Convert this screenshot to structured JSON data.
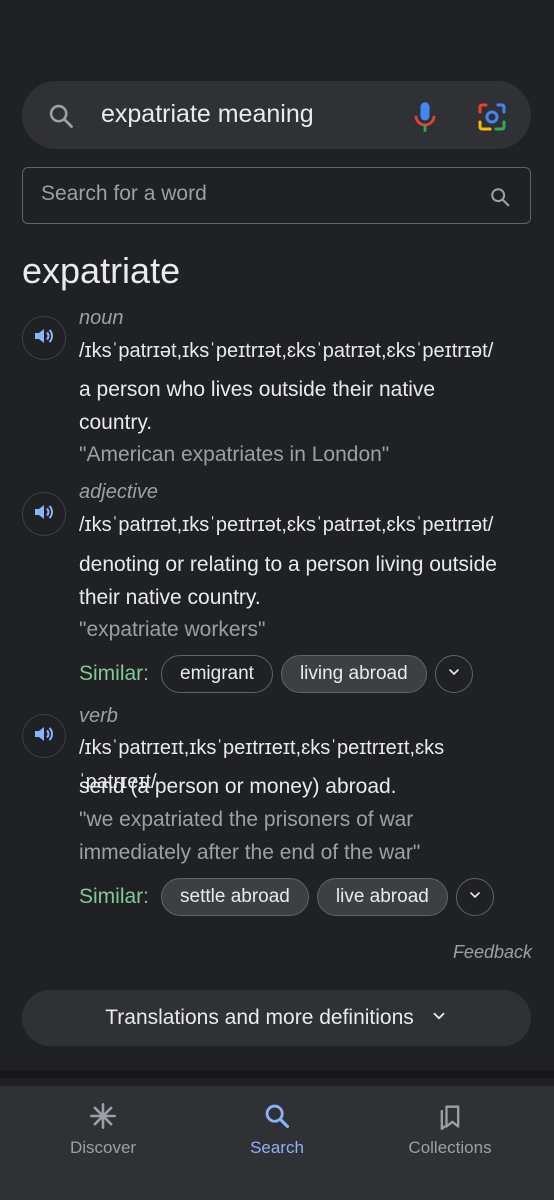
{
  "search": {
    "query": "expatriate meaning"
  },
  "dictionary": {
    "search_placeholder": "Search for a word",
    "headword": "expatriate",
    "entries": [
      {
        "pos": "noun",
        "phonetic": "/ɪksˈpatrɪət,ɪksˈpeɪtrɪət,ɛksˈpatrɪət,ɛksˈpeɪtrɪət/",
        "definition": "a person who lives outside their native country.",
        "example": "\"American expatriates in London\""
      },
      {
        "pos": "adjective",
        "phonetic": "/ɪksˈpatrɪət,ɪksˈpeɪtrɪət,ɛksˈpatrɪət,ɛksˈpeɪtrɪət/",
        "definition": "denoting or relating to a person living outside their native country.",
        "example": "\"expatriate workers\"",
        "similar_label": "Similar:",
        "similar": [
          "emigrant",
          "living abroad"
        ]
      },
      {
        "pos": "verb",
        "phonetic": "/ɪksˈpatrɪeɪt,ɪksˈpeɪtrɪeɪt,ɛksˈpeɪtrɪeɪt,ɛksˈpatrɪeɪt/",
        "definition": "send (a person or money) abroad.",
        "example": "\"we expatriated the prisoners of war immediately after the end of the war\"",
        "similar_label": "Similar:",
        "similar": [
          "settle abroad",
          "live abroad"
        ]
      }
    ],
    "feedback": "Feedback",
    "more_definitions": "Translations and more definitions"
  },
  "nav": {
    "items": [
      {
        "label": "Discover",
        "icon": "asterisk-icon"
      },
      {
        "label": "Search",
        "icon": "search-icon",
        "active": true
      },
      {
        "label": "Collections",
        "icon": "collections-icon"
      }
    ]
  },
  "colors": {
    "background": "#202124",
    "surface": "#303134",
    "accent_blue": "#8ab4f8",
    "similar_green": "#81c995"
  }
}
